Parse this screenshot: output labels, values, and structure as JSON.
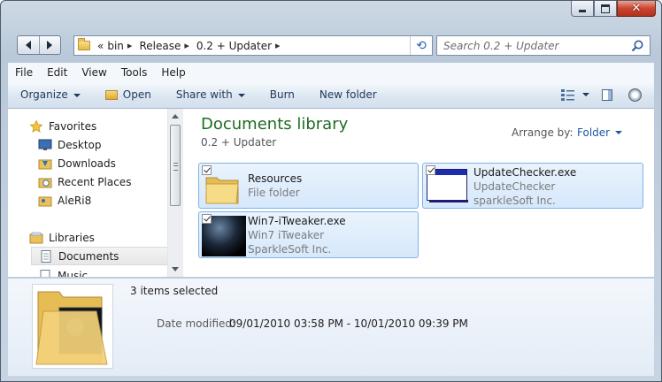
{
  "window": {
    "minimize_icon": "minimize-icon",
    "maximize_icon": "maximize-icon",
    "close_icon": "close-icon"
  },
  "address_bar": {
    "overflow": "«",
    "crumbs": [
      "bin",
      "Release",
      "0.2 + Updater"
    ],
    "refresh_icon": "refresh-icon"
  },
  "search": {
    "placeholder": "Search 0.2 + Updater"
  },
  "menu": [
    "File",
    "Edit",
    "View",
    "Tools",
    "Help"
  ],
  "toolbar": {
    "organize": "Organize",
    "open": "Open",
    "share_with": "Share with",
    "burn": "Burn",
    "new_folder": "New folder"
  },
  "nav": {
    "favorites": "Favorites",
    "items": [
      "Desktop",
      "Downloads",
      "Recent Places",
      "AleRi8"
    ],
    "libraries": "Libraries",
    "lib_items": [
      "Documents",
      "Music"
    ]
  },
  "content": {
    "title": "Documents library",
    "subtitle": "0.2 + Updater",
    "arrange_label": "Arrange by:",
    "arrange_value": "Folder",
    "files": [
      {
        "name": "Resources",
        "line2": "File folder",
        "line3": ""
      },
      {
        "name": "UpdateChecker.exe",
        "line2": "UpdateChecker",
        "line3": "sparkleSoft Inc."
      },
      {
        "name": "Win7-iTweaker.exe",
        "line2": "Win7 iTweaker",
        "line3": "SparkleSoft Inc."
      }
    ]
  },
  "details": {
    "selection": "3 items selected",
    "date_modified_label": "Date modified:",
    "date_modified_value": "09/01/2010 03:58 PM - 10/01/2010 09:39 PM"
  },
  "colors": {
    "library_title": "#1e6c23",
    "link": "#1f57a8",
    "selection_border": "#7eb4ea",
    "close_button": "#c9452e"
  }
}
